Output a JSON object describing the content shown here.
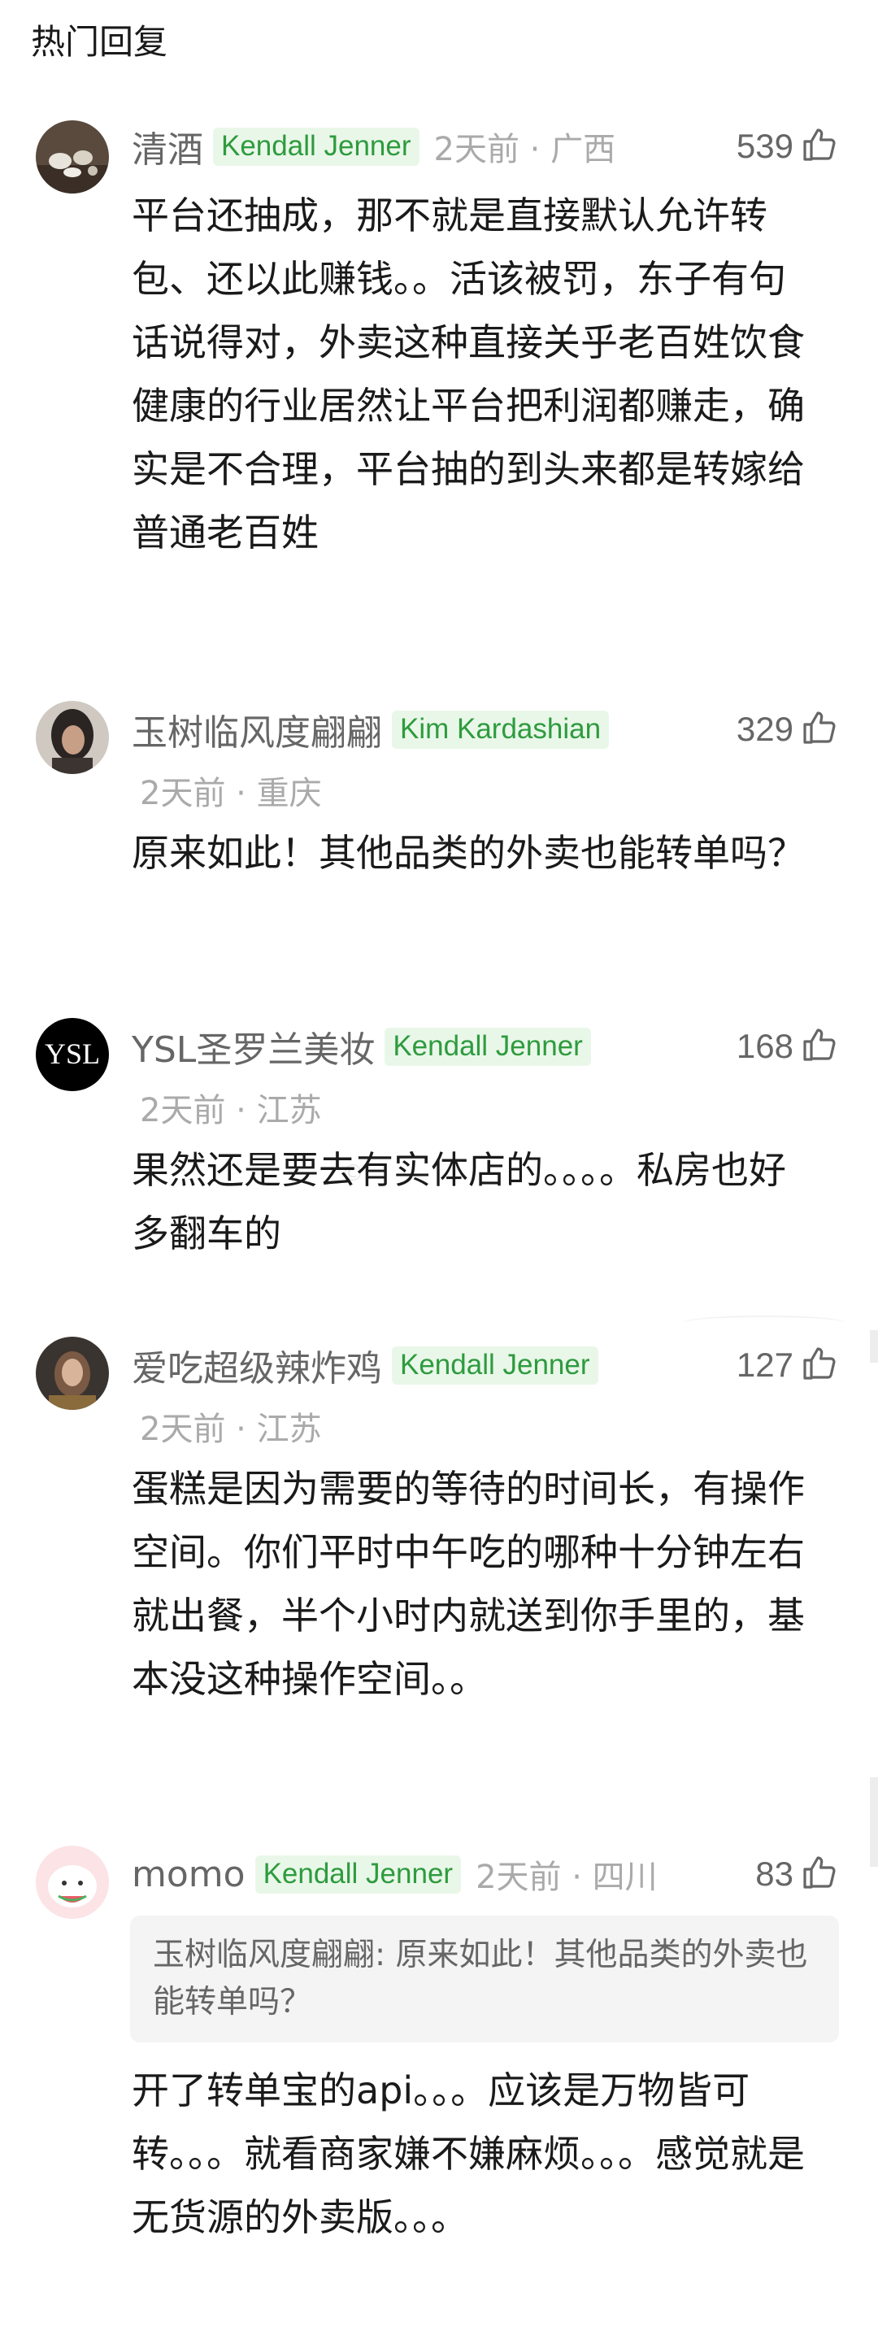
{
  "section_title": "热门回复",
  "watermark": "©",
  "comments": [
    {
      "username": "清酒",
      "badge": "Kendall Jenner",
      "meta": "2天前 · 广西",
      "likes": "539",
      "body": "平台还抽成，那不就是直接默认允许转包、还以此赚钱。。活该被罚，东子有句话说得对，外卖这种直接关乎老百姓饮食健康的行业居然让平台把利润都赚走，确实是不合理，平台抽的到头来都是转嫁给普通老百姓",
      "avatar_icon": "tea-set-avatar"
    },
    {
      "username": "玉树临风度翩翩",
      "badge": "Kim Kardashian",
      "meta": "2天前 · 重庆",
      "likes": "329",
      "body": "原来如此！其他品类的外卖也能转单吗？",
      "avatar_icon": "person-avatar"
    },
    {
      "username": "YSL圣罗兰美妆",
      "badge": "Kendall Jenner",
      "meta": "2天前 · 江苏",
      "likes": "168",
      "body": "果然还是要去有实体店的。。。。私房也好多翻车的",
      "avatar_icon": "ysl-logo-avatar"
    },
    {
      "username": "爱吃超级辣炸鸡",
      "badge": "Kendall Jenner",
      "meta": "2天前 · 江苏",
      "likes": "127",
      "body": "蛋糕是因为需要的等待的时间长，有操作空间。你们平时中午吃的哪种十分钟左右就出餐，半个小时内就送到你手里的，基本没这种操作空间。。",
      "avatar_icon": "portrait-avatar"
    },
    {
      "username": "momo",
      "badge": "Kendall Jenner",
      "meta": "2天前 · 四川",
      "likes": "83",
      "quote": "玉树临风度翩翩: 原来如此！其他品类的外卖也能转单吗？",
      "body": "开了转单宝的api。。。应该是万物皆可转。。。就看商家嫌不嫌麻烦。。。感觉就是无货源的外卖版。。。",
      "avatar_icon": "watermelon-cartoon-avatar"
    }
  ]
}
